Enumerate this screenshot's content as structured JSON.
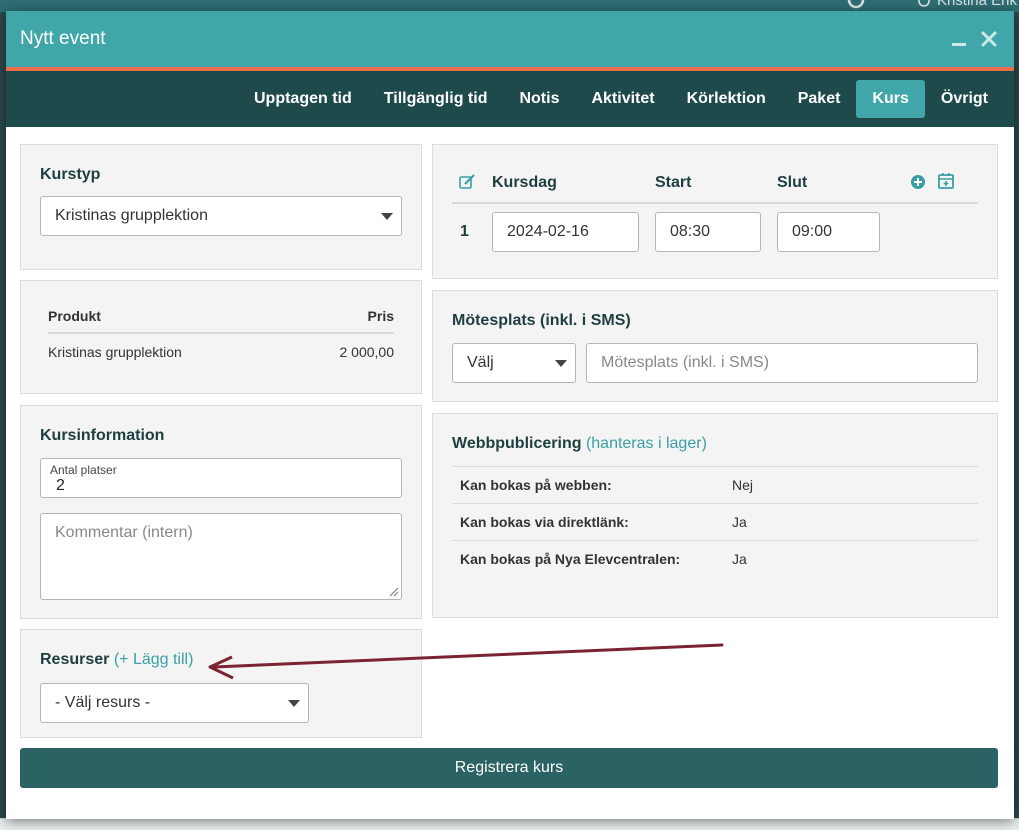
{
  "background": {
    "user_name": "Kristina Erik"
  },
  "modal": {
    "title": "Nytt event"
  },
  "tabs": [
    {
      "label": "Upptagen tid",
      "active": false
    },
    {
      "label": "Tillgänglig tid",
      "active": false
    },
    {
      "label": "Notis",
      "active": false
    },
    {
      "label": "Aktivitet",
      "active": false
    },
    {
      "label": "Körlektion",
      "active": false
    },
    {
      "label": "Paket",
      "active": false
    },
    {
      "label": "Kurs",
      "active": true
    },
    {
      "label": "Övrigt",
      "active": false
    }
  ],
  "kurstyp": {
    "title": "Kurstyp",
    "selected": "Kristinas grupplektion"
  },
  "products": {
    "col_product": "Produkt",
    "col_price": "Pris",
    "rows": [
      {
        "product": "Kristinas grupplektion",
        "price": "2 000,00"
      }
    ]
  },
  "kursinformation": {
    "title": "Kursinformation",
    "seats_label": "Antal platser",
    "seats_value": "2",
    "comment_placeholder": "Kommentar (intern)"
  },
  "resurser": {
    "title": "Resurser",
    "add_open": "(",
    "add_link": "+ Lägg till",
    "add_close": ")",
    "select_value": "- Välj resurs -"
  },
  "schedule": {
    "col_day": "Kursdag",
    "col_start": "Start",
    "col_end": "Slut",
    "rows": [
      {
        "index": "1",
        "date": "2024-02-16",
        "start": "08:30",
        "end": "09:00"
      }
    ]
  },
  "motesplats": {
    "title": "Mötesplats (inkl. i SMS)",
    "select_value": "Välj",
    "placeholder": "Mötesplats (inkl. i SMS)"
  },
  "webbpublicering": {
    "title": "Webbpublicering",
    "paren_open": "(",
    "link": "hanteras i lager",
    "paren_close": ")",
    "rows": [
      {
        "key": "Kan bokas på webben:",
        "value": "Nej"
      },
      {
        "key": "Kan bokas via direktlänk:",
        "value": "Ja"
      },
      {
        "key": "Kan bokas på Nya Elevcentralen:",
        "value": "Ja"
      }
    ]
  },
  "submit_label": "Registrera kurs",
  "colors": {
    "header": "#41a6a9",
    "header_accent": "#ec6b4b",
    "tabbar": "#1e4a4c",
    "submit": "#2b6264",
    "annotation_arrow": "#7a2333"
  },
  "icons": [
    "search-icon",
    "user-icon",
    "minimize-icon",
    "close-icon",
    "edit-icon",
    "add-circle-icon",
    "calendar-add-icon",
    "caret-down-icon",
    "annotation-arrow"
  ]
}
